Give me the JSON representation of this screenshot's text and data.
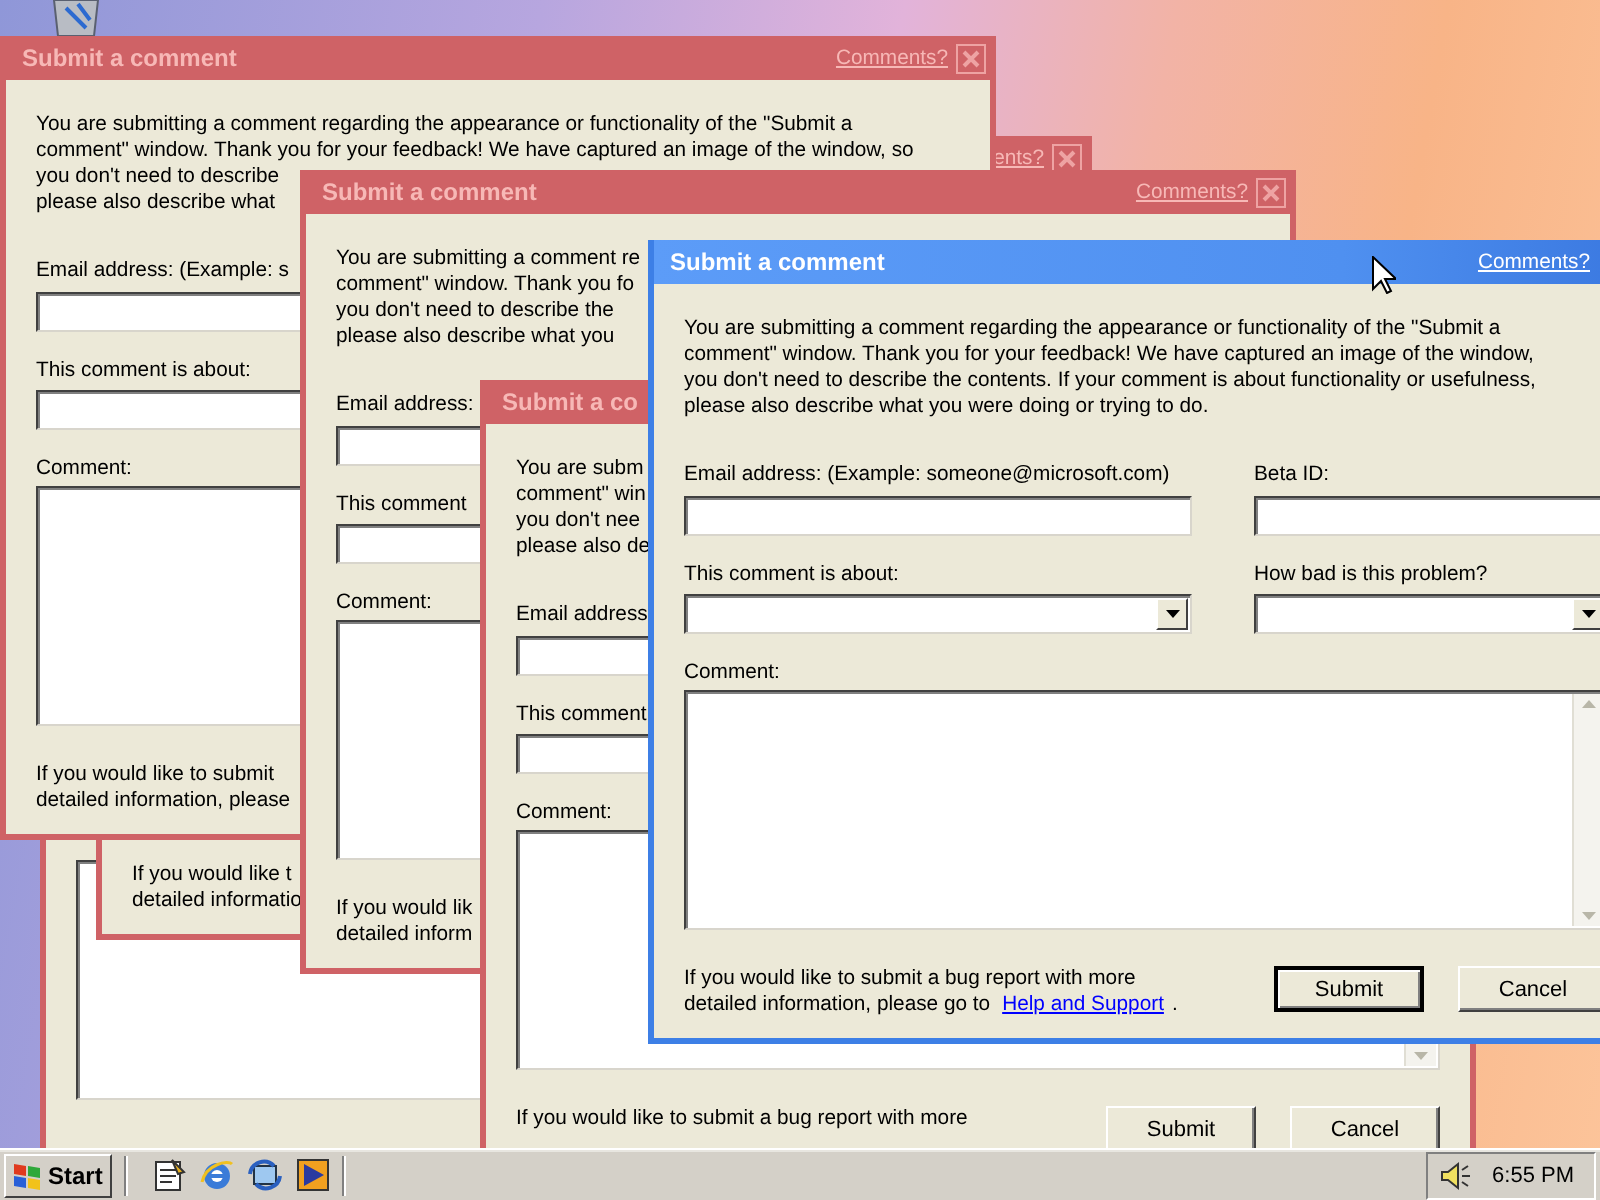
{
  "windows": [
    {
      "active": false,
      "comment_box": {
        "kind": "textarea"
      }
    },
    {
      "active": false,
      "comments_link": "ents?",
      "close_button": true,
      "footer_lines": [
        "If you would like t",
        "detailed informatio"
      ]
    },
    {
      "active": false,
      "title": "Submit a comment",
      "comments_link": "Comments?",
      "close_button": true,
      "intro_lines": [
        "You are submitting a comment regarding the appearance or functionality of the \"Submit a",
        "comment\" window. Thank you for your feedback! We have captured an image of the window, so",
        "you don't need to describe",
        "please also describe what"
      ],
      "email_label": "Email address: (Example: s",
      "email_input": {
        "kind": "text"
      },
      "about_label": "This comment is about:",
      "about_input": {
        "kind": "text"
      },
      "comment_label": "Comment:",
      "comment_box": {
        "kind": "textarea"
      },
      "footer_lines": [
        "If you would like to submit",
        "detailed information, please"
      ]
    },
    {
      "active": false,
      "title": "Submit a comment",
      "comments_link": "Comments?",
      "close_button": true,
      "intro_lines": [
        "You are submitting a comment re",
        "comment\" window. Thank you fo",
        "you don't need to describe the",
        "please also describe what you"
      ],
      "email_label": "Email address:",
      "email_input": {
        "kind": "text"
      },
      "about_label": "This comment",
      "about_input": {
        "kind": "text"
      },
      "comment_label": "Comment:",
      "comment_box": {
        "kind": "textarea"
      },
      "footer_lines": [
        "If you would lik",
        "detailed inform"
      ]
    },
    {
      "active": false,
      "title": "Submit a co",
      "intro_lines": [
        "You are subm",
        "comment\" win",
        "you don't nee",
        "please also de"
      ],
      "email_label": "Email address",
      "email_input": {
        "kind": "text"
      },
      "about_label": "This comment",
      "about_input": {
        "kind": "text"
      },
      "comment_label": "Comment:",
      "comment_box": {
        "kind": "textarea",
        "scrollbar": true
      },
      "footer_lines": [
        "If you would like to submit a bug report with more"
      ],
      "buttons": [
        {
          "label": "Submit",
          "default": false
        },
        {
          "label": "Cancel",
          "default": false
        }
      ]
    },
    {
      "active": true,
      "title": "Submit a comment",
      "comments_link": "Comments?",
      "intro_lines": [
        "You are submitting a comment regarding the appearance or functionality of the \"Submit a",
        "comment\" window. Thank you for your feedback! We have captured an image of the window,",
        "you don't need to describe the contents. If your comment is about functionality or usefulness,",
        "please also describe what you were doing or trying to do."
      ],
      "email_label": "Email address: (Example: someone@microsoft.com)",
      "email_input": {
        "kind": "text"
      },
      "beta_label": "Beta ID:",
      "beta_input": {
        "kind": "text"
      },
      "about_label": "This comment is about:",
      "about_input": {
        "kind": "dropdown"
      },
      "severity_label": "How bad is this problem?",
      "severity_input": {
        "kind": "dropdown"
      },
      "comment_label": "Comment:",
      "comment_box": {
        "kind": "textarea",
        "scrollbar": true
      },
      "footer_lines": [
        "If you would like to submit a bug report with more",
        "detailed information, please go to"
      ],
      "help_link": "Help and Support",
      "footer_end": ".",
      "buttons": [
        {
          "label": "Submit",
          "default": true
        },
        {
          "label": "Cancel",
          "default": false
        }
      ]
    }
  ],
  "taskbar": {
    "start_label": "Start",
    "clock": "6:55 PM"
  }
}
